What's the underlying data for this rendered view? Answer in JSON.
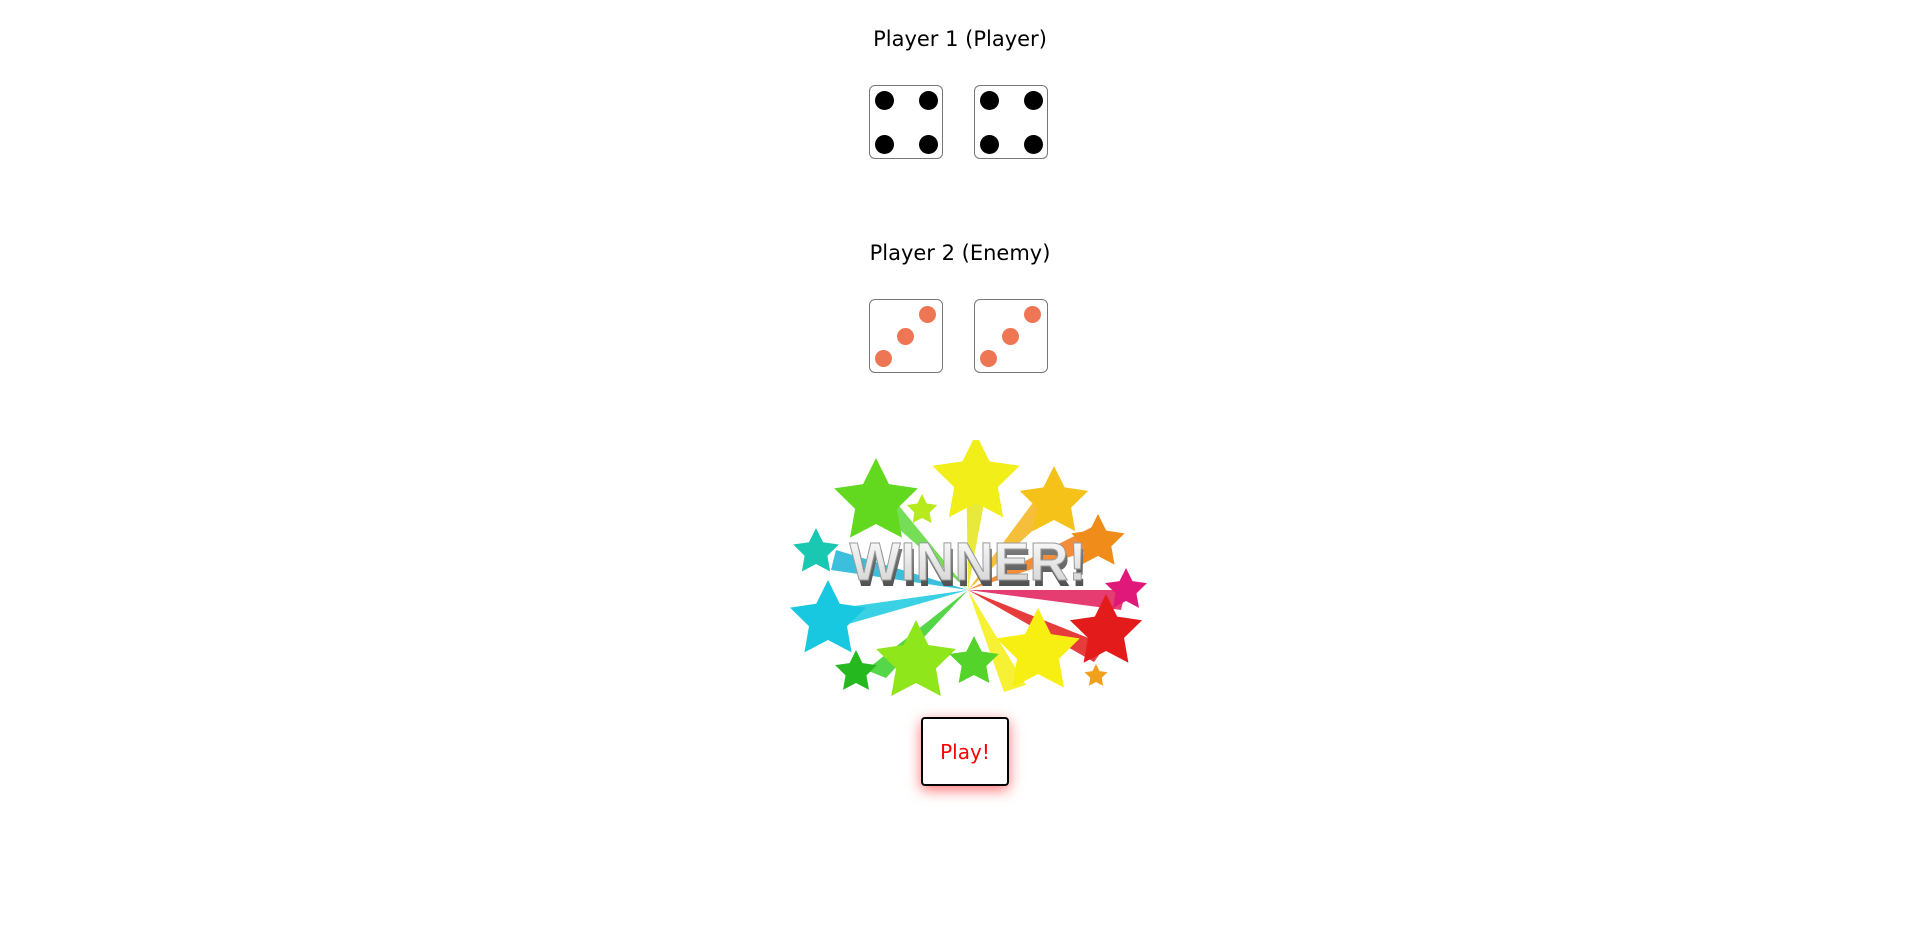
{
  "player1": {
    "title": "Player 1 (Player)",
    "dice": [
      4,
      4
    ],
    "pip_color": "#000000"
  },
  "player2": {
    "title": "Player 2 (Enemy)",
    "dice": [
      3,
      3
    ],
    "pip_color": "#ef7654"
  },
  "result": {
    "banner_text": "WINNER!"
  },
  "controls": {
    "play_label": "Play!",
    "play_color": "#ff0000"
  }
}
